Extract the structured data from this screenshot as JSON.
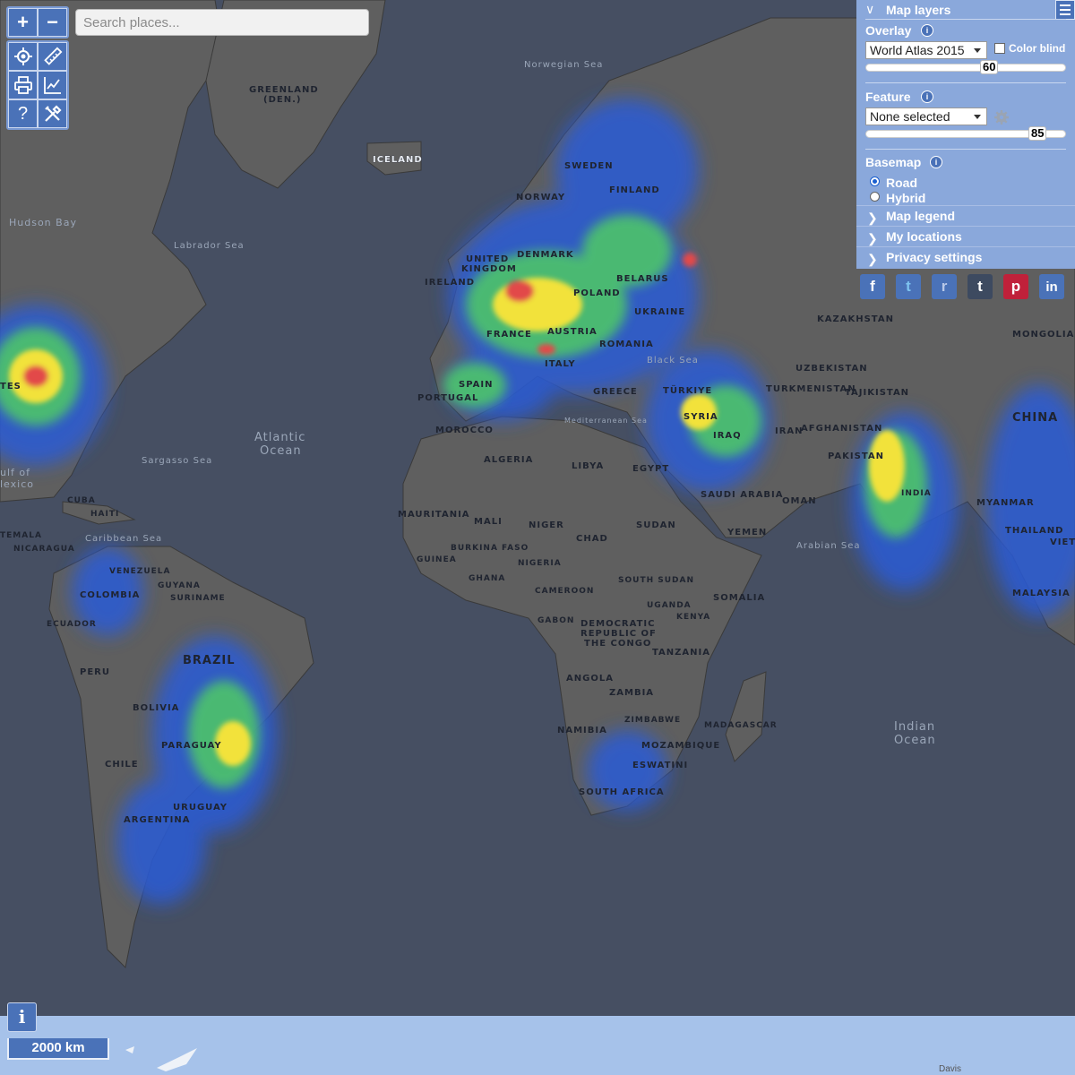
{
  "search": {
    "placeholder": "Search places..."
  },
  "toolbar": {
    "zoom_in": "+",
    "zoom_out": "−",
    "help": "?"
  },
  "panel": {
    "title": "Map layers",
    "overlay_label": "Overlay",
    "overlay_value": "World Atlas 2015",
    "color_blind_label": "Color blind",
    "overlay_opacity": "60",
    "feature_label": "Feature",
    "feature_value": "None selected",
    "feature_opacity": "85",
    "basemap_label": "Basemap",
    "basemap_options": [
      "Road",
      "Hybrid"
    ],
    "basemap_selected": "Road",
    "sections": [
      "Map legend",
      "My locations",
      "Privacy settings"
    ]
  },
  "share": {
    "icons": [
      "facebook-icon",
      "twitter-icon",
      "reddit-icon",
      "tumblr-icon",
      "pinterest-icon",
      "linkedin-icon"
    ],
    "glyphs": [
      "f",
      "t",
      "r",
      "t",
      "p",
      "in"
    ]
  },
  "scale_bar": "2000 km",
  "info_button": "i",
  "map_labels": {
    "greenland": "GREENLAND",
    "greenland_sub": "(DEN.)",
    "iceland": "ICELAND",
    "sweden": "SWEDEN",
    "norway": "NORWAY",
    "finland": "FINLAND",
    "denmark": "DENMARK",
    "united_kingdom_1": "UNITED",
    "united_kingdom_2": "KINGDOM",
    "ireland": "IRELAND",
    "belarus": "BELARUS",
    "poland": "POLAND",
    "ukraine": "UKRAINE",
    "france": "FRANCE",
    "austria": "AUSTRIA",
    "romania": "ROMANIA",
    "italy": "ITALY",
    "spain": "SPAIN",
    "portugal": "PORTUGAL",
    "greece": "GREECE",
    "turkiye": "TÜRKIYE",
    "kazakhstan": "KAZAKHSTAN",
    "mongolia": "MONGOLIA",
    "uzbekistan": "UZBEKISTAN",
    "turkmenistan": "TURKMENISTAN",
    "tajikistan": "TAJIKISTAN",
    "china": "CHINA",
    "afghanistan": "AFGHANISTAN",
    "pakistan": "PAKISTAN",
    "iran": "IRAN",
    "iraq": "IRAQ",
    "syria": "SYRIA",
    "saudi_arabia": "SAUDI ARABIA",
    "oman": "OMAN",
    "yemen": "YEMEN",
    "india": "INDIA",
    "myanmar": "MYANMAR",
    "thailand": "THAILAND",
    "malaysia": "MALAYSIA",
    "morocco": "MOROCCO",
    "algeria": "ALGERIA",
    "libya": "LIBYA",
    "egypt": "EGYPT",
    "mauritania": "MAURITANIA",
    "mali": "MALI",
    "niger": "NIGER",
    "chad": "CHAD",
    "sudan": "SUDAN",
    "burkina_faso": "BURKINA FASO",
    "guinea": "GUINEA",
    "nigeria": "NIGERIA",
    "ghana": "GHANA",
    "cameroon": "CAMEROON",
    "south_sudan": "SOUTH SUDAN",
    "somalia": "SOMALIA",
    "uganda": "UGANDA",
    "kenya": "KENYA",
    "gabon": "GABON",
    "drc_1": "DEMOCRATIC",
    "drc_2": "REPUBLIC OF",
    "drc_3": "THE CONGO",
    "tanzania": "TANZANIA",
    "angola": "ANGOLA",
    "zambia": "ZAMBIA",
    "zimbabwe": "ZIMBABWE",
    "namibia": "NAMIBIA",
    "mozambique": "MOZAMBIQUE",
    "madagascar": "MADAGASCAR",
    "eswatini": "ESWATINI",
    "south_africa": "SOUTH AFRICA",
    "cuba": "CUBA",
    "haiti": "HAITI",
    "venezuela": "VENEZUELA",
    "guyana": "GUYANA",
    "suriname": "SURINAME",
    "colombia": "COLOMBIA",
    "ecuador": "ECUADOR",
    "peru": "PERU",
    "brazil": "BRAZIL",
    "bolivia": "BOLIVIA",
    "paraguay": "PARAGUAY",
    "chile": "CHILE",
    "uruguay": "URUGUAY",
    "argentina": "ARGENTINA",
    "usa_fragment": "TES",
    "guatemala_fragment": "TEMALA",
    "nicaragua": "NICARAGUA",
    "vietnam_fragment": "VIET",
    "norwegian_sea": "Norwegian Sea",
    "hudson_bay": "Hudson Bay",
    "labrador_sea": "Labrador Sea",
    "atlantic_1": "Atlantic",
    "atlantic_2": "Ocean",
    "sargasso_sea": "Sargasso Sea",
    "gulf_1": "ulf of",
    "gulf_2": "lexico",
    "caribbean_sea": "Caribbean Sea",
    "black_sea": "Black Sea",
    "mediterranean_sea": "Mediterranean Sea",
    "arabian_sea": "Arabian Sea",
    "indian_1": "Indian",
    "indian_2": "Ocean",
    "davis": "Davis"
  }
}
